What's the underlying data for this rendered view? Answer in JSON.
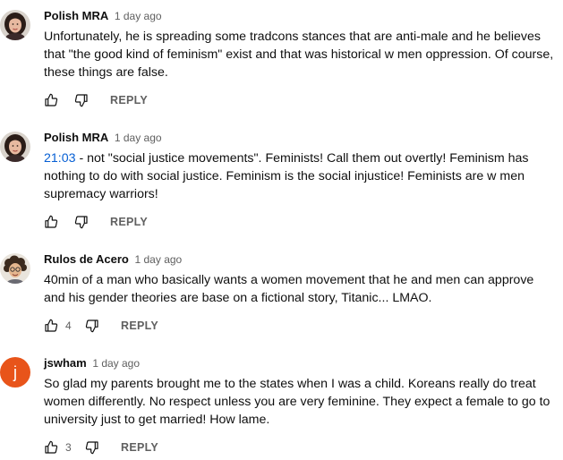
{
  "comments": [
    {
      "author": "Polish MRA",
      "time": "1 day ago",
      "avatar": "woman-portrait",
      "lines": [
        "Unfortunately, he is spreading some tradcons stances that are anti-male and he believes",
        "that \"the good kind of feminism\" exist and that was historical w men oppression. Of course,",
        "these things are false."
      ],
      "likes": "",
      "reply_label": "REPLY"
    },
    {
      "author": "Polish MRA",
      "time": "1 day ago",
      "avatar": "woman-portrait",
      "timestamp_link": "21:03",
      "lines": [
        " - not \"social justice movements\". Feminists! Call them out overtly! Feminism has",
        "nothing to do with social justice. Feminism is the social injustice! Feminists are w men",
        "supremacy warriors!"
      ],
      "likes": "",
      "reply_label": "REPLY"
    },
    {
      "author": "Rulos de Acero",
      "time": "1 day ago",
      "avatar": "curly-hair-portrait",
      "lines": [
        "40min of a man who basically wants a women movement that he and men can approve",
        "and his gender theories are base on  a fictional story, Titanic... LMAO."
      ],
      "likes": "4",
      "reply_label": "REPLY"
    },
    {
      "author": "jswham",
      "time": "1 day ago",
      "avatar_letter": "j",
      "avatar_color": "#e8541a",
      "lines": [
        "So glad my parents brought me to the states when I was a child. Koreans really do treat",
        "women differently. No respect unless you are very feminine. They expect a female to go to",
        "university just to get married! How lame."
      ],
      "likes": "3",
      "reply_label": "REPLY"
    }
  ],
  "icons": {
    "like": "thumbs-up-icon",
    "dislike": "thumbs-down-icon"
  }
}
